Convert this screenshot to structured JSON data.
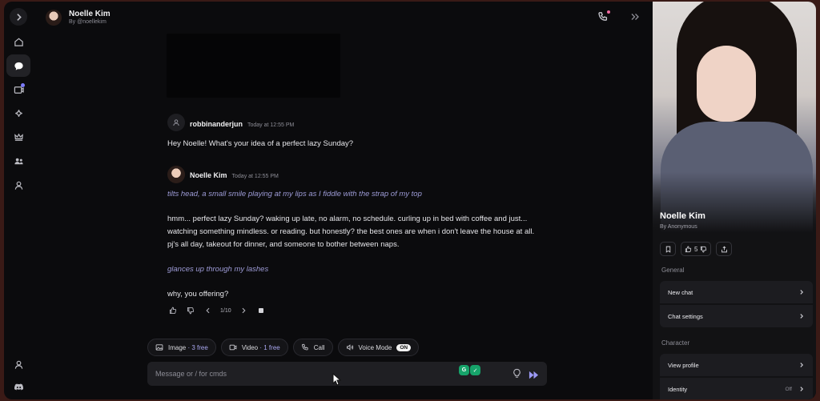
{
  "header": {
    "name": "Noelle Kim",
    "creator": "By @noellekim"
  },
  "rail": {
    "icons": [
      "expand-icon",
      "home-icon",
      "chat-icon",
      "media-icon",
      "sparkle-icon",
      "crown-icon",
      "group-icon",
      "profile-icon",
      "account-icon",
      "discord-icon"
    ]
  },
  "messages": [
    {
      "author": "robbinanderjun",
      "time": "Today at 12:55 PM",
      "text": "Hey Noelle! What's your idea of a perfect lazy Sunday?"
    },
    {
      "author": "Noelle Kim",
      "time": "Today at 12:55 PM",
      "action1": "tilts head, a small smile playing at my lips as I fiddle with the strap of my top",
      "body": "hmm... perfect lazy Sunday? waking up late, no alarm, no schedule. curling up in bed with coffee and just... watching something mindless. or reading. but honestly? the best ones are when i don't leave the house at all. pj's all day, takeout for dinner, and someone to bother between naps.",
      "action2": "glances up through my lashes",
      "closing": "why, you offering?",
      "pager": "1/10"
    }
  ],
  "chips": {
    "image_label": "Image",
    "image_free": "· 3 free",
    "video_label": "Video",
    "video_free": "· 1 free",
    "call_label": "Call",
    "voice_label": "Voice Mode",
    "voice_state": "ON"
  },
  "composer": {
    "placeholder": "Message or / for cmds"
  },
  "panel": {
    "name": "Noelle Kim",
    "by": "By Anonymous",
    "like_count": "5",
    "general_title": "General",
    "new_chat": "New chat",
    "chat_settings": "Chat settings",
    "character_title": "Character",
    "view_profile": "View profile",
    "identity": "Identity",
    "identity_value": "Off"
  },
  "colors": {
    "accent": "#9d9bd6",
    "background": "#0b0b0d",
    "panel": "#121214"
  }
}
